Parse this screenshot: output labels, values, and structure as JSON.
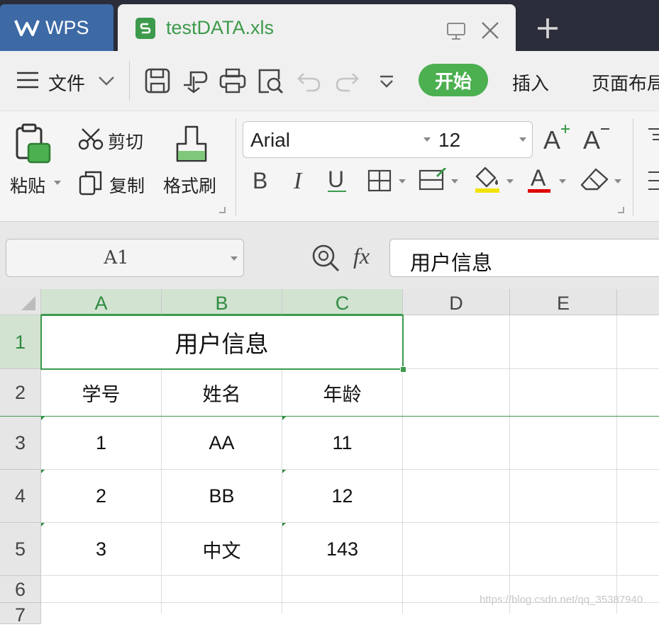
{
  "tabs": {
    "app_label": "WPS",
    "file_label": "testDATA.xls"
  },
  "menu": {
    "file": "文件",
    "start": "开始",
    "insert": "插入",
    "page_layout": "页面布局"
  },
  "ribbon": {
    "paste": "粘贴",
    "cut": "剪切",
    "copy": "复制",
    "format_painter": "格式刷",
    "font_name": "Arial",
    "font_size": "12",
    "bold": "B",
    "italic": "I",
    "underline": "U",
    "font_color_letter": "A",
    "grow_letter": "A",
    "shrink_letter": "A",
    "colors": {
      "highlight": "#f2e200",
      "font_color": "#e00000",
      "accent": "#4caf50"
    }
  },
  "formula": {
    "cell_ref": "A1",
    "fx_label": "fx",
    "value": "用户信息"
  },
  "sheet": {
    "columns": [
      "A",
      "B",
      "C",
      "D",
      "E"
    ],
    "rows": [
      "1",
      "2",
      "3",
      "4",
      "5",
      "6",
      "7"
    ],
    "title": "用户信息",
    "header": [
      "学号",
      "姓名",
      "年龄"
    ],
    "data": [
      [
        "1",
        "AA",
        "11"
      ],
      [
        "2",
        "BB",
        "12"
      ],
      [
        "3",
        "中文",
        "143"
      ]
    ]
  },
  "watermark": "https://blog.csdn.net/qq_35387940"
}
